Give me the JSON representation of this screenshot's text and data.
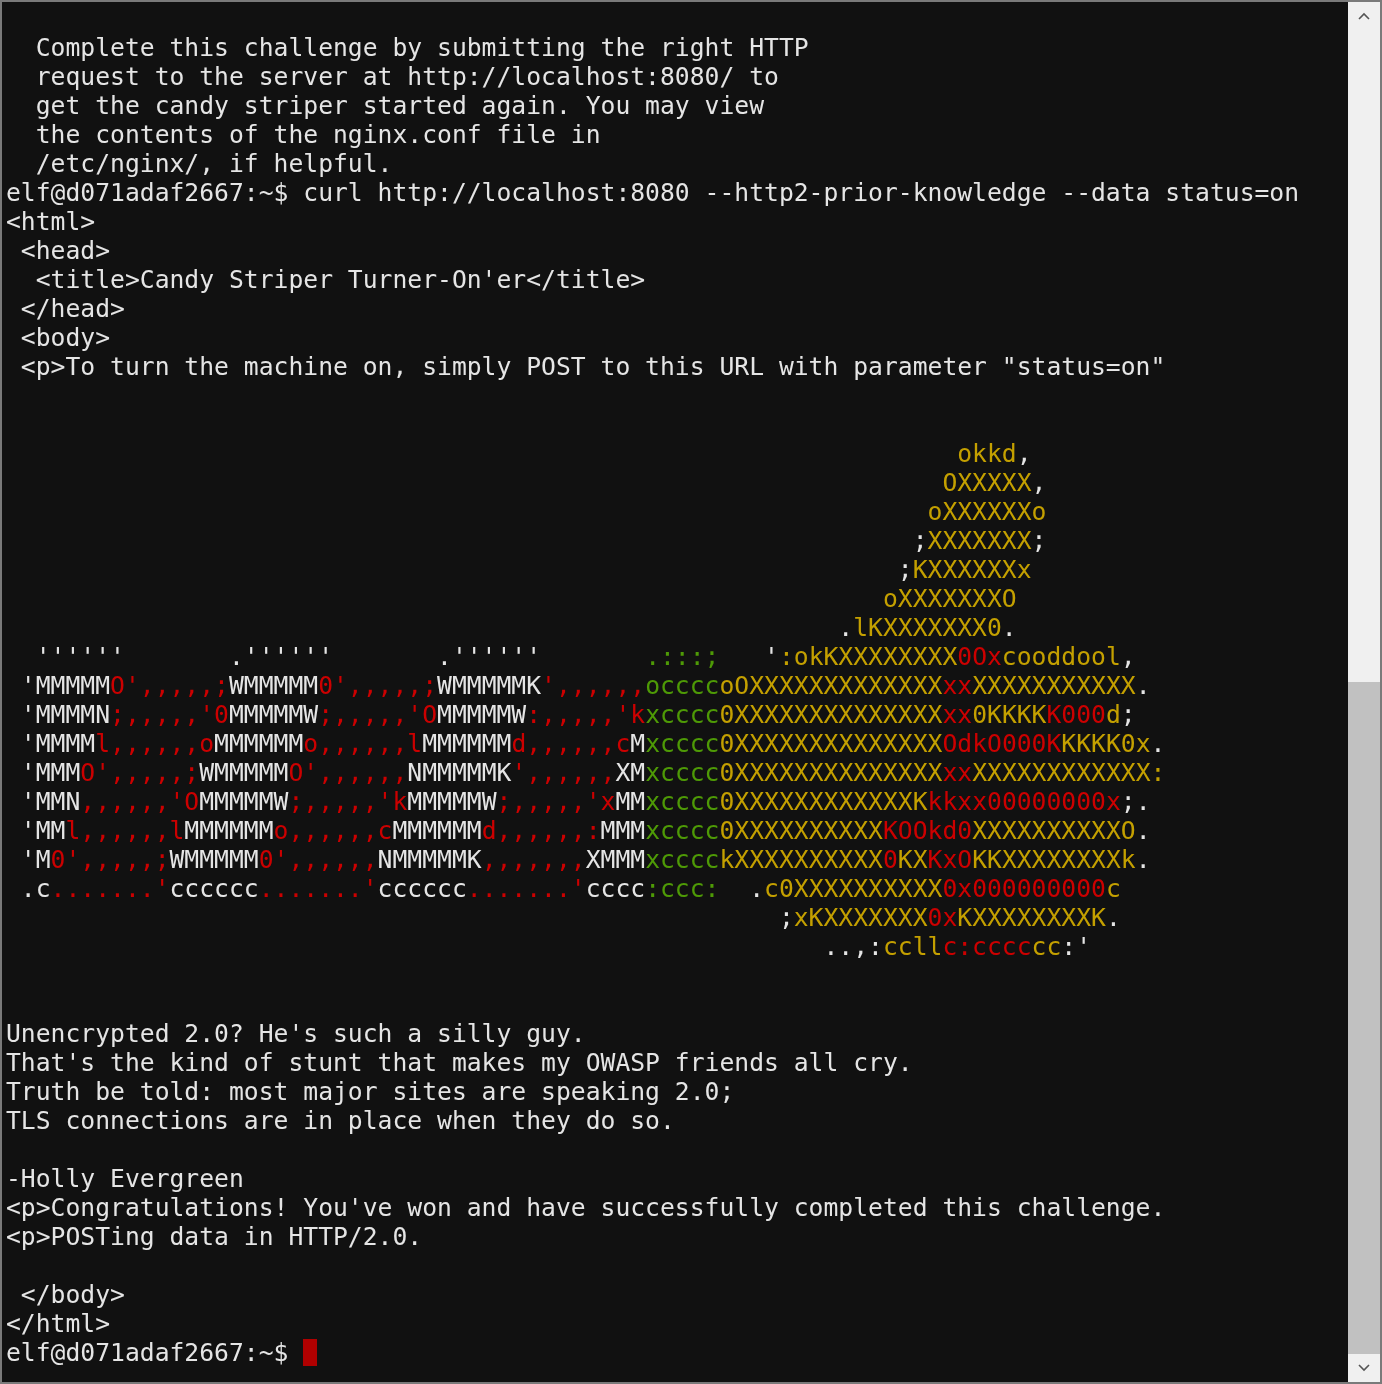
{
  "terminal": {
    "lines": [
      {
        "kind": "text",
        "text": "  Complete this challenge by submitting the right HTTP"
      },
      {
        "kind": "text",
        "text": "  request to the server at http://localhost:8080/ to"
      },
      {
        "kind": "text",
        "text": "  get the candy striper started again. You may view"
      },
      {
        "kind": "text",
        "text": "  the contents of the nginx.conf file in"
      },
      {
        "kind": "text",
        "text": "  /etc/nginx/, if helpful."
      },
      {
        "kind": "text",
        "text": "elf@d071adaf2667:~$ curl http://localhost:8080 --http2-prior-knowledge --data status=on"
      },
      {
        "kind": "text",
        "text": "<html>"
      },
      {
        "kind": "text",
        "text": " <head>"
      },
      {
        "kind": "text",
        "text": "  <title>Candy Striper Turner-On'er</title>"
      },
      {
        "kind": "text",
        "text": " </head>"
      },
      {
        "kind": "text",
        "text": " <body>"
      },
      {
        "kind": "text",
        "text": " <p>To turn the machine on, simply POST to this URL with parameter \"status=on\""
      },
      {
        "kind": "blank"
      },
      {
        "kind": "blank"
      },
      {
        "kind": "art",
        "spans": [
          {
            "text": "                                                                okkd",
            "color": "#c4a000"
          },
          {
            "text": ",",
            "color": "#e5e5e5"
          }
        ]
      },
      {
        "kind": "art",
        "spans": [
          {
            "text": "                                                               OXXXXX",
            "color": "#c4a000"
          },
          {
            "text": ",",
            "color": "#e5e5e5"
          }
        ]
      },
      {
        "kind": "art",
        "spans": [
          {
            "text": "                                                              oXXXXXXo",
            "color": "#c4a000"
          }
        ]
      },
      {
        "kind": "art",
        "spans": [
          {
            "text": "                                                             ;",
            "color": "#e5e5e5"
          },
          {
            "text": "XXXXXXX",
            "color": "#c4a000"
          },
          {
            "text": ";",
            "color": "#e5e5e5"
          }
        ]
      },
      {
        "kind": "art",
        "spans": [
          {
            "text": "                                                            ;",
            "color": "#e5e5e5"
          },
          {
            "text": "KXXXXXXx",
            "color": "#c4a000"
          }
        ]
      },
      {
        "kind": "art",
        "spans": [
          {
            "text": "                                                           oXXXXXXXO",
            "color": "#c4a000"
          }
        ]
      },
      {
        "kind": "art",
        "spans": [
          {
            "text": "                                                        .",
            "color": "#e5e5e5"
          },
          {
            "text": "lKXXXXXXX0",
            "color": "#c4a000"
          },
          {
            "text": ".",
            "color": "#e5e5e5"
          }
        ]
      },
      {
        "kind": "art",
        "spans": [
          {
            "text": "  ''''''       .''''''       .''''''       ",
            "color": "#e5e5e5"
          },
          {
            "text": ".:::;",
            "color": "#4e9a06"
          },
          {
            "text": "   '",
            "color": "#e5e5e5"
          },
          {
            "text": ":okKXXXXXXXX",
            "color": "#c4a000"
          },
          {
            "text": "0Ox",
            "color": "#cc0000"
          },
          {
            "text": "cooddool",
            "color": "#c4a000"
          },
          {
            "text": ",",
            "color": "#e5e5e5"
          }
        ]
      },
      {
        "kind": "art",
        "spans": [
          {
            "text": " 'MMMMM",
            "color": "#e5e5e5"
          },
          {
            "text": "O',,,,,;",
            "color": "#cc0000"
          },
          {
            "text": "WMMMMM",
            "color": "#e5e5e5"
          },
          {
            "text": "0',,,,,;",
            "color": "#cc0000"
          },
          {
            "text": "WMMMMMK",
            "color": "#e5e5e5"
          },
          {
            "text": "',,,,,,",
            "color": "#cc0000"
          },
          {
            "text": "occcc",
            "color": "#4e9a06"
          },
          {
            "text": "oOXXXXXXXXXXXXX",
            "color": "#c4a000"
          },
          {
            "text": "xx",
            "color": "#cc0000"
          },
          {
            "text": "XXXXXXXXXXX",
            "color": "#c4a000"
          },
          {
            "text": ".",
            "color": "#e5e5e5"
          }
        ]
      },
      {
        "kind": "art",
        "spans": [
          {
            "text": " 'MMMMN",
            "color": "#e5e5e5"
          },
          {
            "text": ";,,,,,'0",
            "color": "#cc0000"
          },
          {
            "text": "MMMMMW",
            "color": "#e5e5e5"
          },
          {
            "text": ";,,,,,'O",
            "color": "#cc0000"
          },
          {
            "text": "MMMMMW",
            "color": "#e5e5e5"
          },
          {
            "text": ":,,,,,'k",
            "color": "#cc0000"
          },
          {
            "text": "xcccc",
            "color": "#4e9a06"
          },
          {
            "text": "0XXXXXXXXXXXXXX",
            "color": "#c4a000"
          },
          {
            "text": "xx",
            "color": "#cc0000"
          },
          {
            "text": "0KKKK",
            "color": "#c4a000"
          },
          {
            "text": "K000",
            "color": "#cc0000"
          },
          {
            "text": "d",
            "color": "#c4a000"
          },
          {
            "text": ";",
            "color": "#e5e5e5"
          }
        ]
      },
      {
        "kind": "art",
        "spans": [
          {
            "text": " 'MMMM",
            "color": "#e5e5e5"
          },
          {
            "text": "l,,,,,,o",
            "color": "#cc0000"
          },
          {
            "text": "MMMMMM",
            "color": "#e5e5e5"
          },
          {
            "text": "o,,,,,,l",
            "color": "#cc0000"
          },
          {
            "text": "MMMMMM",
            "color": "#e5e5e5"
          },
          {
            "text": "d,,,,,,c",
            "color": "#cc0000"
          },
          {
            "text": "M",
            "color": "#e5e5e5"
          },
          {
            "text": "xcccc",
            "color": "#4e9a06"
          },
          {
            "text": "0XXXXXXXXXXXXXX",
            "color": "#c4a000"
          },
          {
            "text": "OdkO000K",
            "color": "#cc0000"
          },
          {
            "text": "KKKK0x",
            "color": "#c4a000"
          },
          {
            "text": ".",
            "color": "#e5e5e5"
          }
        ]
      },
      {
        "kind": "art",
        "spans": [
          {
            "text": " 'MMM",
            "color": "#e5e5e5"
          },
          {
            "text": "O',,,,,;",
            "color": "#cc0000"
          },
          {
            "text": "WMMMMM",
            "color": "#e5e5e5"
          },
          {
            "text": "O',,,,,,",
            "color": "#cc0000"
          },
          {
            "text": "NMMMMMK",
            "color": "#e5e5e5"
          },
          {
            "text": "',,,,,,",
            "color": "#cc0000"
          },
          {
            "text": "XM",
            "color": "#e5e5e5"
          },
          {
            "text": "xcccc",
            "color": "#4e9a06"
          },
          {
            "text": "0XXXXXXXXXXXXXX",
            "color": "#c4a000"
          },
          {
            "text": "xx",
            "color": "#cc0000"
          },
          {
            "text": "XXXXXXXXXXXX:",
            "color": "#c4a000"
          }
        ]
      },
      {
        "kind": "art",
        "spans": [
          {
            "text": " 'MMN",
            "color": "#e5e5e5"
          },
          {
            "text": ",,,,,,'O",
            "color": "#cc0000"
          },
          {
            "text": "MMMMMW",
            "color": "#e5e5e5"
          },
          {
            "text": ";,,,,,'k",
            "color": "#cc0000"
          },
          {
            "text": "MMMMMW",
            "color": "#e5e5e5"
          },
          {
            "text": ";,,,,,'x",
            "color": "#cc0000"
          },
          {
            "text": "MM",
            "color": "#e5e5e5"
          },
          {
            "text": "xcccc",
            "color": "#4e9a06"
          },
          {
            "text": "0XXXXXXXXXXXXK",
            "color": "#c4a000"
          },
          {
            "text": "kkxx00000000x",
            "color": "#cc0000"
          },
          {
            "text": ";.",
            "color": "#e5e5e5"
          }
        ]
      },
      {
        "kind": "art",
        "spans": [
          {
            "text": " 'MM",
            "color": "#e5e5e5"
          },
          {
            "text": "l,,,,,,l",
            "color": "#cc0000"
          },
          {
            "text": "MMMMMM",
            "color": "#e5e5e5"
          },
          {
            "text": "o,,,,,,c",
            "color": "#cc0000"
          },
          {
            "text": "MMMMMM",
            "color": "#e5e5e5"
          },
          {
            "text": "d,,,,,,:",
            "color": "#cc0000"
          },
          {
            "text": "MMM",
            "color": "#e5e5e5"
          },
          {
            "text": "xcccc",
            "color": "#4e9a06"
          },
          {
            "text": "0XXXXXXXXXX",
            "color": "#c4a000"
          },
          {
            "text": "KOOkd0",
            "color": "#cc0000"
          },
          {
            "text": "XXXXXXXXXXO",
            "color": "#c4a000"
          },
          {
            "text": ".",
            "color": "#e5e5e5"
          }
        ]
      },
      {
        "kind": "art",
        "spans": [
          {
            "text": " 'M",
            "color": "#e5e5e5"
          },
          {
            "text": "0',,,,,;",
            "color": "#cc0000"
          },
          {
            "text": "WMMMMM",
            "color": "#e5e5e5"
          },
          {
            "text": "0',,,,,,",
            "color": "#cc0000"
          },
          {
            "text": "NMMMMMK",
            "color": "#e5e5e5"
          },
          {
            "text": ",,,,,,,",
            "color": "#cc0000"
          },
          {
            "text": "XMMM",
            "color": "#e5e5e5"
          },
          {
            "text": "xcccc",
            "color": "#4e9a06"
          },
          {
            "text": "kXXXXXXXXXX",
            "color": "#c4a000"
          },
          {
            "text": "0",
            "color": "#cc0000"
          },
          {
            "text": "KX",
            "color": "#c4a000"
          },
          {
            "text": "KxO",
            "color": "#cc0000"
          },
          {
            "text": "KKXXXXXXXXk",
            "color": "#c4a000"
          },
          {
            "text": ".",
            "color": "#e5e5e5"
          }
        ]
      },
      {
        "kind": "art",
        "spans": [
          {
            "text": " .c",
            "color": "#e5e5e5"
          },
          {
            "text": ".......'",
            "color": "#cc0000"
          },
          {
            "text": "cccccc",
            "color": "#e5e5e5"
          },
          {
            "text": ".......'",
            "color": "#cc0000"
          },
          {
            "text": "cccccc",
            "color": "#e5e5e5"
          },
          {
            "text": ".......'",
            "color": "#cc0000"
          },
          {
            "text": "cccc",
            "color": "#e5e5e5"
          },
          {
            "text": ":ccc:",
            "color": "#4e9a06"
          },
          {
            "text": "  .",
            "color": "#e5e5e5"
          },
          {
            "text": "c0XXXXXXXXXX",
            "color": "#c4a000"
          },
          {
            "text": "0x000000000",
            "color": "#cc0000"
          },
          {
            "text": "c",
            "color": "#c4a000"
          }
        ]
      },
      {
        "kind": "art",
        "spans": [
          {
            "text": "                                                    ;",
            "color": "#e5e5e5"
          },
          {
            "text": "xKXXXXXXX",
            "color": "#c4a000"
          },
          {
            "text": "0x",
            "color": "#cc0000"
          },
          {
            "text": "KXXXXXXXXK",
            "color": "#c4a000"
          },
          {
            "text": ".",
            "color": "#e5e5e5"
          }
        ]
      },
      {
        "kind": "art",
        "spans": [
          {
            "text": "                                                       ..,:",
            "color": "#e5e5e5"
          },
          {
            "text": "ccll",
            "color": "#c4a000"
          },
          {
            "text": "c:cccc",
            "color": "#cc0000"
          },
          {
            "text": "cc",
            "color": "#c4a000"
          },
          {
            "text": ":'",
            "color": "#e5e5e5"
          }
        ]
      },
      {
        "kind": "blank"
      },
      {
        "kind": "blank"
      },
      {
        "kind": "text",
        "text": "Unencrypted 2.0? He's such a silly guy."
      },
      {
        "kind": "text",
        "text": "That's the kind of stunt that makes my OWASP friends all cry."
      },
      {
        "kind": "text",
        "text": "Truth be told: most major sites are speaking 2.0;"
      },
      {
        "kind": "text",
        "text": "TLS connections are in place when they do so."
      },
      {
        "kind": "blank"
      },
      {
        "kind": "text",
        "text": "-Holly Evergreen"
      },
      {
        "kind": "text",
        "text": "<p>Congratulations! You've won and have successfully completed this challenge."
      },
      {
        "kind": "text",
        "text": "<p>POSTing data in HTTP/2.0."
      },
      {
        "kind": "blank"
      },
      {
        "kind": "text",
        "text": " </body>"
      },
      {
        "kind": "text",
        "text": "</html>"
      },
      {
        "kind": "prompt",
        "text": "elf@d071adaf2667:~$ ",
        "cursor": true
      }
    ]
  }
}
